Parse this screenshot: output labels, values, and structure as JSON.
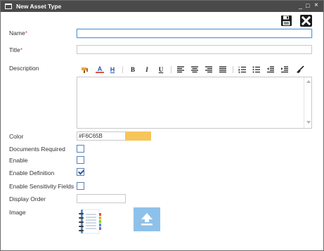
{
  "window": {
    "title": "New Asset Type",
    "minimize": "_",
    "maximize": "□",
    "close": "×"
  },
  "toolbar": {
    "save_icon": "floppy-disk-icon",
    "close_icon": "close-icon"
  },
  "fields": {
    "name_label": "Name",
    "title_label": "Title",
    "required_mark": "*",
    "description_label": "Description",
    "color_label": "Color",
    "color_value": "#F6C65B",
    "documents_required_label": "Documents Required",
    "enable_label": "Enable",
    "enable_definition_label": "Enable Definition",
    "enable_sensitivity_fields_label": "Enable Sensitivity Fields",
    "display_order_label": "Display Order",
    "image_label": "Image"
  },
  "checkboxes": {
    "documents_required": false,
    "enable": false,
    "enable_definition": true,
    "enable_sensitivity_fields": false
  },
  "rte": {
    "bold": "B",
    "italic": "I",
    "underline": "U",
    "font_color": "A",
    "highlight": "H"
  },
  "colors": {
    "titlebar": "#4a4a4a",
    "swatch": "#F6C65B",
    "upload_bg": "#8ec1ea",
    "required": "#d9534f"
  }
}
